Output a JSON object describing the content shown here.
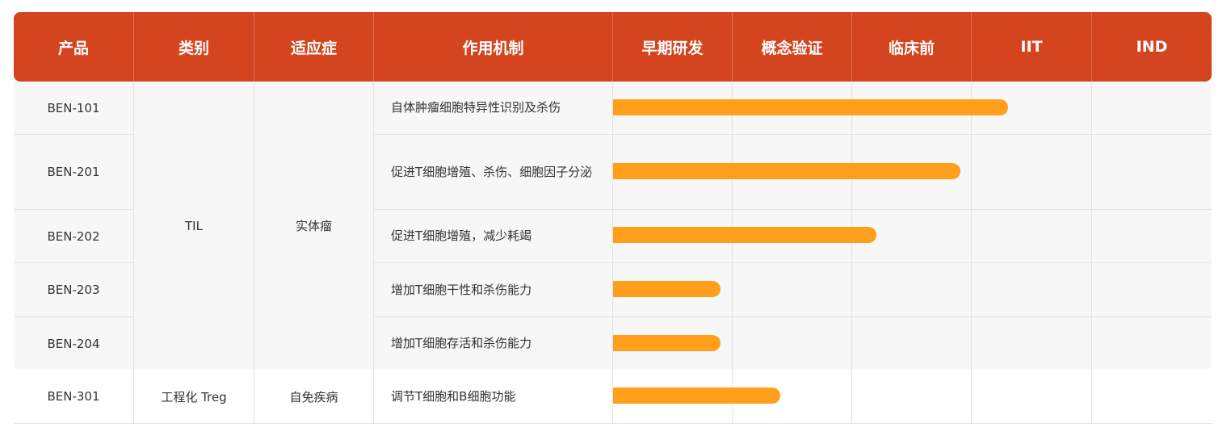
{
  "header": {
    "columns": [
      "产品",
      "类别",
      "适应症",
      "作用机制",
      "早期研发",
      "概念验证",
      "临床前",
      "IIT",
      "IND"
    ]
  },
  "groups": [
    {
      "category": "TIL",
      "indication": "实体瘤"
    },
    {
      "category": "工程化 Treg",
      "indication": "自免疾病"
    }
  ],
  "rows": [
    {
      "product": "BEN-101",
      "mechanism": "自体肿瘤细胞特异性识别及杀伤",
      "progress": 0.66
    },
    {
      "product": "BEN-201",
      "mechanism": "促进T细胞增殖、杀伤、细胞因子分泌",
      "progress": 0.58
    },
    {
      "product": "BEN-202",
      "mechanism": "促进T细胞增殖，减少耗竭",
      "progress": 0.44
    },
    {
      "product": "BEN-203",
      "mechanism": "增加T细胞干性和杀伤能力",
      "progress": 0.18
    },
    {
      "product": "BEN-204",
      "mechanism": "增加T细胞存活和杀伤能力",
      "progress": 0.18
    },
    {
      "product": "BEN-301",
      "mechanism": "调节T细胞和B细胞功能",
      "progress": 0.28
    }
  ],
  "colors": {
    "header_bg": "#d4441f",
    "band_bg": "#f7f7f7",
    "bar": "#ff9f1c",
    "grid": "#e3e3e3"
  }
}
